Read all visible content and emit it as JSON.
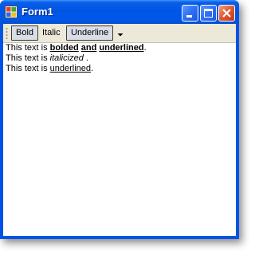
{
  "window": {
    "title": "Form1",
    "icon": "form-app-icon",
    "controls": [
      "minimize-icon",
      "maximize-icon",
      "close-icon"
    ]
  },
  "toolbar": {
    "buttons": [
      {
        "label": "Bold",
        "checked": true
      },
      {
        "label": "Italic",
        "checked": false
      },
      {
        "label": "Underline",
        "checked": true
      }
    ],
    "overflow_icon": "chevron-down-icon"
  },
  "richtext": {
    "line1": {
      "prefix": "This text is ",
      "word1": "bolded",
      "space1": " ",
      "word2": "and",
      "space2": " ",
      "word3": "underlined",
      "suffix": "."
    },
    "line2": {
      "prefix": "This text is ",
      "word": "italicized",
      "suffix": " ."
    },
    "line3": {
      "prefix": "This text is ",
      "word": "underlined",
      "suffix": "."
    }
  },
  "colors": {
    "titlebar": "#0055e5",
    "toolbar_bg": "#ece9d8",
    "close_button": "#e0582e"
  }
}
